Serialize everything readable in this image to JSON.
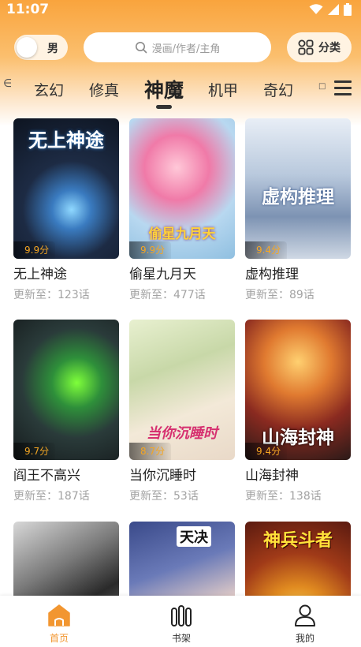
{
  "status_bar": {
    "time": "11:07"
  },
  "top_bar": {
    "gender_label": "男",
    "search_placeholder": "漫画/作者/主角",
    "category_label": "分类"
  },
  "tabs": {
    "items": [
      "玄幻",
      "修真",
      "神魔",
      "机甲",
      "奇幻"
    ],
    "active": "神魔"
  },
  "comics": [
    {
      "title": "无上神途",
      "update": "更新至：123话",
      "rating": "9.9分",
      "cover_text": "无上神途"
    },
    {
      "title": "偷星九月天",
      "update": "更新至：477话",
      "rating": "9.9分",
      "cover_text": "偷星九月天"
    },
    {
      "title": "虚构推理",
      "update": "更新至：89话",
      "rating": "9.4分",
      "cover_text": "虚构推理"
    },
    {
      "title": "阎王不高兴",
      "update": "更新至：187话",
      "rating": "9.7分",
      "cover_text": ""
    },
    {
      "title": "当你沉睡时",
      "update": "更新至：53话",
      "rating": "8.7分",
      "cover_text": "当你沉睡时"
    },
    {
      "title": "山海封神",
      "update": "更新至：138话",
      "rating": "9.4分",
      "cover_text": "山海封神"
    },
    {
      "title": "",
      "update": "",
      "rating": "",
      "cover_text": ""
    },
    {
      "title": "",
      "update": "",
      "rating": "",
      "cover_text": "天决"
    },
    {
      "title": "",
      "update": "",
      "rating": "",
      "cover_text": "神兵斗者"
    }
  ],
  "bottom_nav": {
    "home_label": "首页",
    "shelf_label": "书架",
    "profile_label": "我的"
  },
  "colors": {
    "accent": "#f29630",
    "header_gradient_top": "#f9a43d",
    "rating_text": "#f5a623"
  }
}
